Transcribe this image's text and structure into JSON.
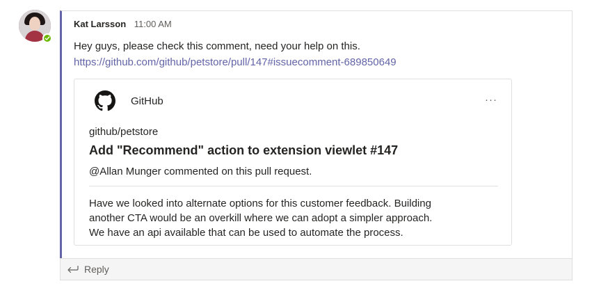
{
  "message": {
    "author": "Kat Larsson",
    "timestamp": "11:00 AM",
    "text": "Hey guys, please check this comment, need your help on this.",
    "link": "https://github.com/github/petstore/pull/147#issuecomment-689850649",
    "presence_color": "#6bb700",
    "accent_color": "#6264a7"
  },
  "card": {
    "source": "GitHub",
    "source_icon": "github-icon",
    "more_label": "···",
    "repo": "github/petstore",
    "title": "Add \"Recommend\" action to extension viewlet #147",
    "activity": "@Allan Munger commented on this pull request.",
    "comment_lines": [
      "Have we looked into alternate options for this customer feedback. Building",
      "another CTA would be an overkill where we can adopt a simpler approach.",
      "We have an api available that can be used to automate the process."
    ]
  },
  "reply": {
    "label": "Reply",
    "icon": "reply-arrow-icon"
  }
}
